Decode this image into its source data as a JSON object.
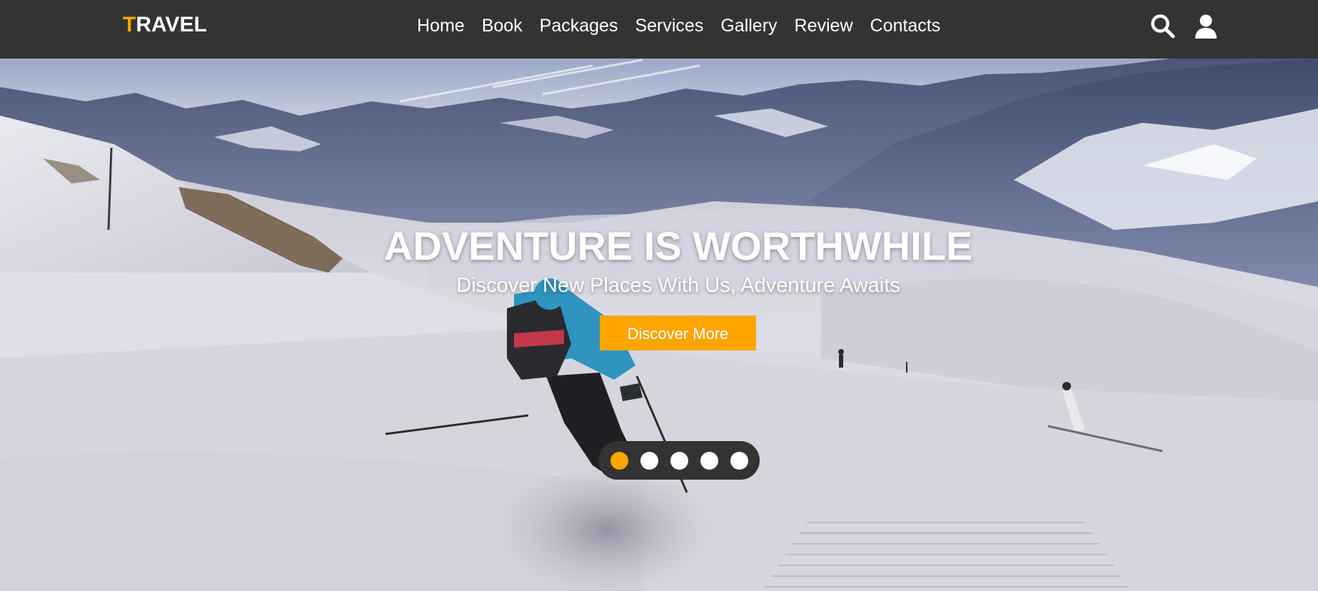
{
  "brand": {
    "logo_first": "T",
    "logo_rest": "RAVEL",
    "accent_color": "#ffa500"
  },
  "nav": {
    "items": [
      {
        "label": "Home"
      },
      {
        "label": "Book"
      },
      {
        "label": "Packages"
      },
      {
        "label": "Services"
      },
      {
        "label": "Gallery"
      },
      {
        "label": "Review"
      },
      {
        "label": "Contacts"
      }
    ]
  },
  "header_icons": {
    "search": "search-icon",
    "user": "user-icon"
  },
  "hero": {
    "title": "ADVENTURE IS WORTHWHILE",
    "subtitle": "Discover New Places With Us, Adventure Awaits",
    "button_label": "Discover More",
    "slides_count": 5,
    "active_slide": 1
  }
}
